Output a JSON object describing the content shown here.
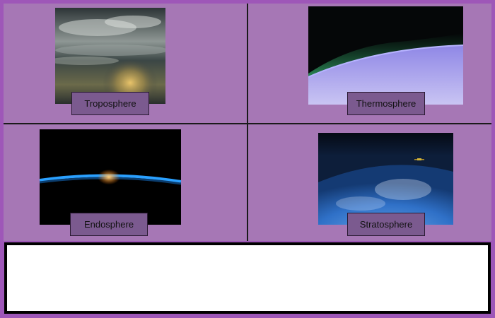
{
  "quiz": {
    "cards": [
      {
        "label": "Troposphere",
        "image": "cloudy-sky-sunset-photo"
      },
      {
        "label": "Thermosphere",
        "image": "aurora-from-orbit-photo"
      },
      {
        "label": "Endosphere",
        "image": "earth-horizon-sunrise-photo"
      },
      {
        "label": "Stratosphere",
        "image": "satellite-over-earth-photo"
      }
    ],
    "answer_text": ""
  },
  "colors": {
    "background": "#9e57b8",
    "panel": "#a677b5",
    "button": "#7b5a8f",
    "divider": "#1a1a1a",
    "answer_box": "#ffffff"
  }
}
